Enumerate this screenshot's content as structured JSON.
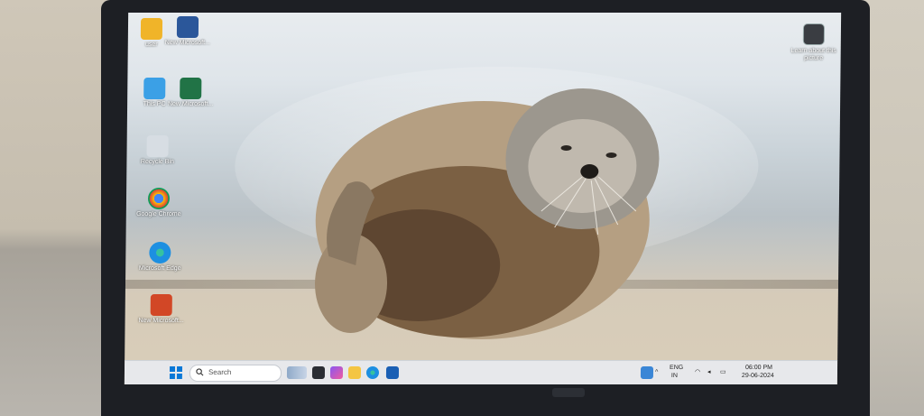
{
  "desktop": {
    "icons": [
      {
        "label": "user",
        "icon": "user-folder-icon",
        "color": "#f0b429"
      },
      {
        "label": "New Microsoft...",
        "icon": "word-icon",
        "color": "#2b579a"
      },
      {
        "label": "This PC",
        "icon": "this-pc-icon",
        "color": "#3ba0e6"
      },
      {
        "label": "New Microsoft...",
        "icon": "excel-icon",
        "color": "#217346"
      },
      {
        "label": "Recycle Bin",
        "icon": "recycle-bin-icon",
        "color": "#d7dde3"
      },
      {
        "label": "Google Chrome",
        "icon": "chrome-icon",
        "color": "#db4437"
      },
      {
        "label": "Microsoft Edge",
        "icon": "edge-icon",
        "color": "#1d8fe1"
      },
      {
        "label": "New Microsoft...",
        "icon": "powerpoint-icon",
        "color": "#d24726"
      }
    ],
    "learn": {
      "label": "Learn about this picture",
      "icon": "camera-icon"
    }
  },
  "taskbar": {
    "search_placeholder": "Search",
    "apps": [
      "start-icon",
      "task-view-icon",
      "copilot-icon",
      "file-explorer-icon",
      "edge-icon",
      "store-icon"
    ],
    "tray": {
      "language_top": "ENG",
      "language_bottom": "IN",
      "time": "06:00 PM",
      "date": "29-06-2024"
    }
  }
}
